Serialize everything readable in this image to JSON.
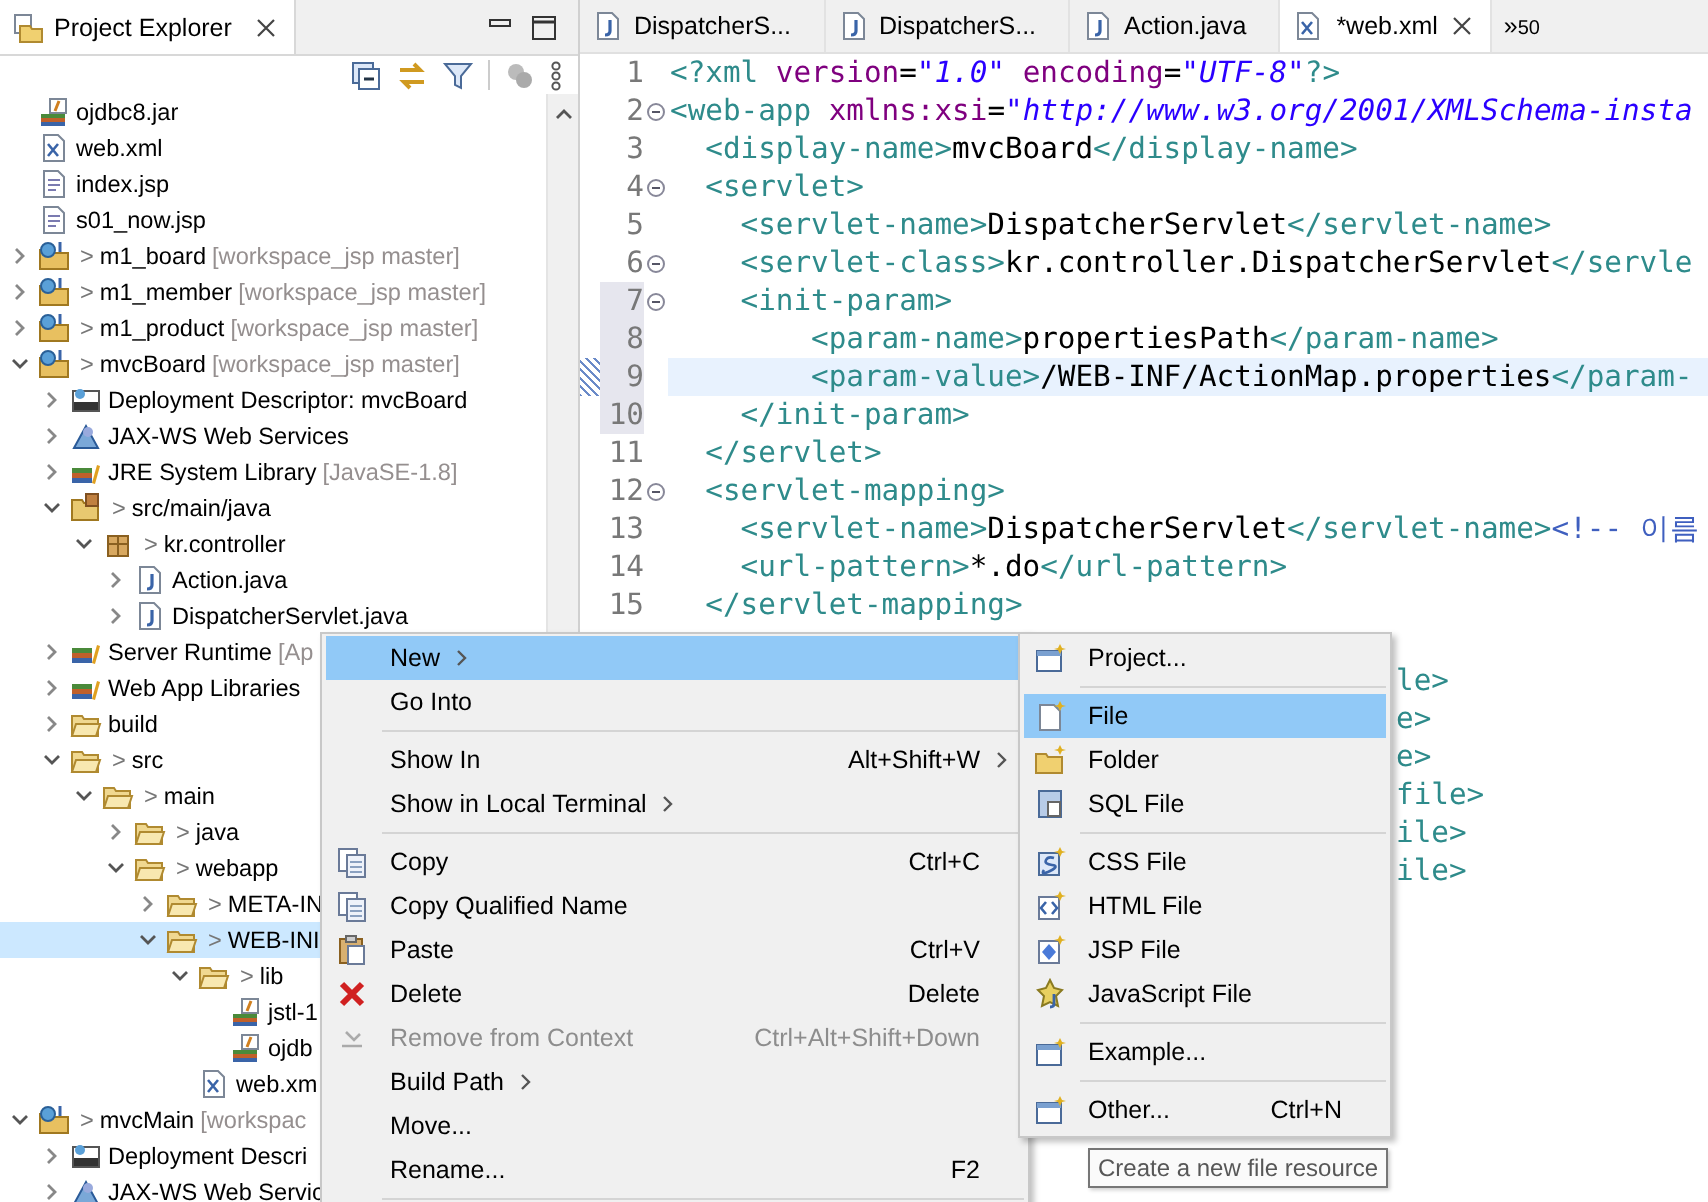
{
  "explorer": {
    "title": "Project Explorer"
  },
  "tree": [
    {
      "label": "ojdbc8.jar",
      "kind": "jar",
      "selected": false
    },
    {
      "label": "web.xml",
      "kind": "xml",
      "selected": false
    },
    {
      "label": "index.jsp",
      "kind": "jsp",
      "selected": false
    },
    {
      "label": "s01_now.jsp",
      "kind": "jsp",
      "selected": false
    },
    {
      "label": "m1_board",
      "prefix": ">",
      "decoration": "[workspace_jsp master]",
      "kind": "project",
      "selected": false,
      "expanded": false
    },
    {
      "label": "m1_member",
      "prefix": ">",
      "decoration": "[workspace_jsp master]",
      "kind": "project",
      "selected": false,
      "expanded": false
    },
    {
      "label": "m1_product",
      "prefix": ">",
      "decoration": "[workspace_jsp master]",
      "kind": "project",
      "selected": false,
      "expanded": false
    },
    {
      "label": "mvcBoard",
      "prefix": ">",
      "decoration": "[workspace_jsp master]",
      "kind": "project",
      "selected": false,
      "expanded": true,
      "children": [
        {
          "label": "Deployment Descriptor: mvcBoard",
          "kind": "descriptor",
          "selected": false,
          "expanded": false
        },
        {
          "label": "JAX-WS Web Services",
          "kind": "webservices",
          "selected": false,
          "expanded": false
        },
        {
          "label": "JRE System Library",
          "decoration": "[JavaSE-1.8]",
          "kind": "library",
          "selected": false,
          "expanded": false
        },
        {
          "label": "src/main/java",
          "prefix": ">",
          "kind": "srcfolder",
          "selected": false,
          "expanded": true,
          "children": [
            {
              "label": "kr.controller",
              "prefix": ">",
              "kind": "package",
              "selected": false,
              "expanded": true,
              "children": [
                {
                  "label": "Action.java",
                  "kind": "java",
                  "selected": false,
                  "expanded": false
                },
                {
                  "label": "DispatcherServlet.java",
                  "kind": "java",
                  "selected": false,
                  "expanded": false
                }
              ]
            }
          ]
        },
        {
          "label": "Server Runtime",
          "decoration": "[Ap",
          "kind": "library",
          "selected": false,
          "expanded": false
        },
        {
          "label": "Web App Libraries",
          "kind": "library",
          "selected": false,
          "expanded": false
        },
        {
          "label": "build",
          "kind": "folder",
          "selected": false,
          "expanded": false
        },
        {
          "label": "src",
          "prefix": ">",
          "kind": "folder",
          "selected": false,
          "expanded": true,
          "children": [
            {
              "label": "main",
              "prefix": ">",
              "kind": "folder",
              "selected": false,
              "expanded": true,
              "children": [
                {
                  "label": "java",
                  "prefix": ">",
                  "kind": "folder",
                  "selected": false,
                  "expanded": false
                },
                {
                  "label": "webapp",
                  "prefix": ">",
                  "kind": "folder",
                  "selected": false,
                  "expanded": true,
                  "children": [
                    {
                      "label": "META-IN",
                      "prefix": ">",
                      "kind": "folder",
                      "selected": false,
                      "expanded": false
                    },
                    {
                      "label": "WEB-INI",
                      "prefix": ">",
                      "kind": "folder",
                      "selected": true,
                      "expanded": true,
                      "children": [
                        {
                          "label": "lib",
                          "prefix": ">",
                          "kind": "folder",
                          "selected": false,
                          "expanded": true,
                          "children": [
                            {
                              "label": "jstl-1",
                              "kind": "jar",
                              "selected": false
                            },
                            {
                              "label": "ojdb",
                              "kind": "jar",
                              "selected": false
                            }
                          ]
                        },
                        {
                          "label": "web.xm",
                          "kind": "xml",
                          "selected": false
                        }
                      ]
                    }
                  ]
                }
              ]
            }
          ]
        }
      ]
    },
    {
      "label": "mvcMain",
      "prefix": ">",
      "decoration": "[workspac",
      "kind": "project",
      "selected": false,
      "expanded": true,
      "children": [
        {
          "label": "Deployment Descri",
          "kind": "descriptor",
          "selected": false,
          "expanded": false
        },
        {
          "label": "JAX-WS Web Servic",
          "kind": "webservices",
          "selected": false,
          "expanded": false
        }
      ]
    }
  ],
  "editor": {
    "tabs": [
      {
        "label": "DispatcherS...",
        "kind": "java",
        "selected": false
      },
      {
        "label": "DispatcherS...",
        "kind": "java",
        "selected": false
      },
      {
        "label": "Action.java",
        "kind": "java",
        "selected": false
      },
      {
        "label": "*web.xml",
        "kind": "xml",
        "selected": true
      }
    ],
    "overflow": {
      "chevron": "»",
      "count": "50"
    },
    "lines": [
      {
        "number": "1",
        "fold": false,
        "in_range": false,
        "current": false,
        "changed": false,
        "tokens": [
          {
            "kind": "tag",
            "text": "<?xml "
          },
          {
            "kind": "attr",
            "text": "version"
          },
          {
            "kind": "punct",
            "text": "="
          },
          {
            "kind": "str",
            "text": "\"1.0\""
          },
          {
            "kind": "attr",
            "text": " encoding"
          },
          {
            "kind": "punct",
            "text": "="
          },
          {
            "kind": "str",
            "text": "\"UTF-8\""
          },
          {
            "kind": "tag",
            "text": "?>"
          }
        ]
      },
      {
        "number": "2",
        "fold": true,
        "in_range": false,
        "current": false,
        "changed": false,
        "tokens": [
          {
            "kind": "tag",
            "text": "<web-app "
          },
          {
            "kind": "attr",
            "text": "xmlns:xsi"
          },
          {
            "kind": "punct",
            "text": "="
          },
          {
            "kind": "str",
            "text": "\"http://www.w3.org/2001/XMLSchema-insta"
          }
        ]
      },
      {
        "number": "3",
        "fold": false,
        "in_range": false,
        "current": false,
        "changed": false,
        "tokens": [
          {
            "kind": "tag",
            "text": "  <display-name>"
          },
          {
            "kind": "text",
            "text": "mvcBoard"
          },
          {
            "kind": "tag",
            "text": "</display-name>"
          }
        ]
      },
      {
        "number": "4",
        "fold": true,
        "in_range": false,
        "current": false,
        "changed": false,
        "tokens": [
          {
            "kind": "tag",
            "text": "  <servlet>"
          }
        ]
      },
      {
        "number": "5",
        "fold": false,
        "in_range": false,
        "current": false,
        "changed": false,
        "tokens": [
          {
            "kind": "tag",
            "text": "    <servlet-name>"
          },
          {
            "kind": "text",
            "text": "DispatcherServlet"
          },
          {
            "kind": "tag",
            "text": "</servlet-name>"
          }
        ]
      },
      {
        "number": "6",
        "fold": true,
        "in_range": false,
        "current": false,
        "changed": false,
        "tokens": [
          {
            "kind": "tag",
            "text": "    <servlet-class>"
          },
          {
            "kind": "text",
            "text": "kr.controller.DispatcherServlet"
          },
          {
            "kind": "tag",
            "text": "</servle"
          }
        ]
      },
      {
        "number": "7",
        "fold": true,
        "in_range": true,
        "current": false,
        "changed": false,
        "tokens": [
          {
            "kind": "tag",
            "text": "    <init-param>"
          }
        ]
      },
      {
        "number": "8",
        "fold": false,
        "in_range": true,
        "current": false,
        "changed": false,
        "tokens": [
          {
            "kind": "tag",
            "text": "        <param-name>"
          },
          {
            "kind": "text",
            "text": "propertiesPath"
          },
          {
            "kind": "tag",
            "text": "</param-name>"
          }
        ]
      },
      {
        "number": "9",
        "fold": false,
        "in_range": true,
        "current": true,
        "changed": true,
        "tokens": [
          {
            "kind": "tag",
            "text": "        <param-value>"
          },
          {
            "kind": "text",
            "text": "/WEB-INF/ActionMap.properties"
          },
          {
            "kind": "tag",
            "text": "</param-"
          }
        ]
      },
      {
        "number": "10",
        "fold": false,
        "in_range": true,
        "current": false,
        "changed": false,
        "tokens": [
          {
            "kind": "tag",
            "text": "    </init-param>"
          }
        ]
      },
      {
        "number": "11",
        "fold": false,
        "in_range": false,
        "current": false,
        "changed": false,
        "tokens": [
          {
            "kind": "tag",
            "text": "  </servlet>"
          }
        ]
      },
      {
        "number": "12",
        "fold": true,
        "in_range": false,
        "current": false,
        "changed": false,
        "tokens": [
          {
            "kind": "tag",
            "text": "  <servlet-mapping>"
          }
        ]
      },
      {
        "number": "13",
        "fold": false,
        "in_range": false,
        "current": false,
        "changed": false,
        "tokens": [
          {
            "kind": "tag",
            "text": "    <servlet-name>"
          },
          {
            "kind": "text",
            "text": "DispatcherServlet"
          },
          {
            "kind": "tag",
            "text": "</servlet-name>"
          },
          {
            "kind": "cmt",
            "text": "<!-- 이름"
          }
        ]
      },
      {
        "number": "14",
        "fold": false,
        "in_range": false,
        "current": false,
        "changed": false,
        "tokens": [
          {
            "kind": "tag",
            "text": "    <url-pattern>"
          },
          {
            "kind": "text",
            "text": "*.do"
          },
          {
            "kind": "tag",
            "text": "</url-pattern>"
          }
        ]
      },
      {
        "number": "15",
        "fold": false,
        "in_range": false,
        "current": false,
        "changed": false,
        "tokens": [
          {
            "kind": "tag",
            "text": "  </servlet-mapping>"
          }
        ]
      }
    ],
    "hidden_tails": [
      "le>",
      "e>",
      "e>",
      "file>",
      "ile>",
      "ile>"
    ]
  },
  "context_menu": {
    "items": [
      {
        "kind": "item",
        "label": "New",
        "submenu": true,
        "selected": true,
        "disabled": false
      },
      {
        "kind": "item",
        "label": "Go Into",
        "submenu": false,
        "selected": false,
        "disabled": false
      },
      {
        "kind": "separator"
      },
      {
        "kind": "item",
        "label": "Show In",
        "shortcut": "Alt+Shift+W",
        "submenu": true,
        "selected": false,
        "disabled": false
      },
      {
        "kind": "item",
        "label": "Show in Local Terminal",
        "submenu": true,
        "selected": false,
        "disabled": false
      },
      {
        "kind": "separator"
      },
      {
        "kind": "item",
        "label": "Copy",
        "shortcut": "Ctrl+C",
        "submenu": false,
        "selected": false,
        "disabled": false
      },
      {
        "kind": "item",
        "label": "Copy Qualified Name",
        "submenu": false,
        "selected": false,
        "disabled": false
      },
      {
        "kind": "item",
        "label": "Paste",
        "shortcut": "Ctrl+V",
        "submenu": false,
        "selected": false,
        "disabled": false
      },
      {
        "kind": "item",
        "label": "Delete",
        "shortcut": "Delete",
        "submenu": false,
        "selected": false,
        "disabled": false
      },
      {
        "kind": "item",
        "label": "Remove from Context",
        "shortcut": "Ctrl+Alt+Shift+Down",
        "submenu": false,
        "selected": false,
        "disabled": true
      },
      {
        "kind": "item",
        "label": "Build Path",
        "submenu": true,
        "selected": false,
        "disabled": false
      },
      {
        "kind": "item",
        "label": "Move...",
        "submenu": false,
        "selected": false,
        "disabled": false
      },
      {
        "kind": "item",
        "label": "Rename...",
        "shortcut": "F2",
        "submenu": false,
        "selected": false,
        "disabled": false
      },
      {
        "kind": "separator"
      }
    ]
  },
  "new_submenu": {
    "items": [
      {
        "kind": "item",
        "label": "Project...",
        "submenu": false,
        "selected": false,
        "disabled": false
      },
      {
        "kind": "separator"
      },
      {
        "kind": "item",
        "label": "File",
        "submenu": false,
        "selected": true,
        "disabled": false
      },
      {
        "kind": "item",
        "label": "Folder",
        "submenu": false,
        "selected": false,
        "disabled": false
      },
      {
        "kind": "item",
        "label": "SQL File",
        "submenu": false,
        "selected": false,
        "disabled": false
      },
      {
        "kind": "separator"
      },
      {
        "kind": "item",
        "label": "CSS File",
        "submenu": false,
        "selected": false,
        "disabled": false
      },
      {
        "kind": "item",
        "label": "HTML File",
        "submenu": false,
        "selected": false,
        "disabled": false
      },
      {
        "kind": "item",
        "label": "JSP File",
        "submenu": false,
        "selected": false,
        "disabled": false
      },
      {
        "kind": "item",
        "label": "JavaScript File",
        "submenu": false,
        "selected": false,
        "disabled": false
      },
      {
        "kind": "separator"
      },
      {
        "kind": "item",
        "label": "Example...",
        "submenu": false,
        "selected": false,
        "disabled": false
      },
      {
        "kind": "separator"
      },
      {
        "kind": "item",
        "label": "Other...",
        "shortcut": "Ctrl+N",
        "submenu": false,
        "selected": false,
        "disabled": false
      }
    ]
  },
  "tooltip": {
    "text": "Create a new file resource"
  }
}
